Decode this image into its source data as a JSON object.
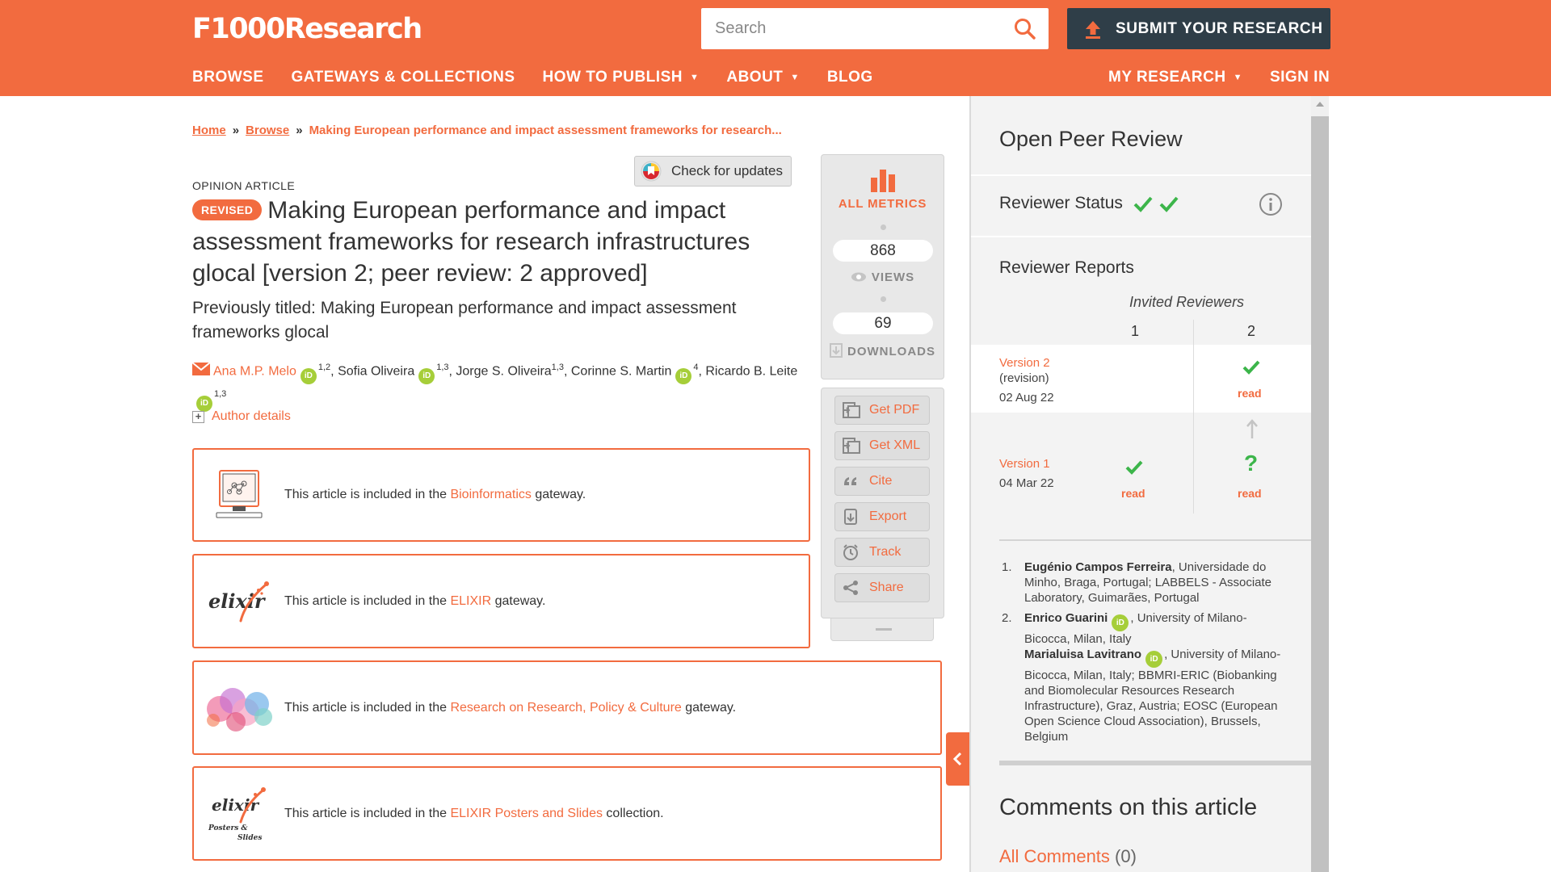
{
  "header": {
    "logo": "F1000Research",
    "search_placeholder": "Search",
    "submit_label": "SUBMIT YOUR RESEARCH",
    "nav_left": [
      "BROWSE",
      "GATEWAYS & COLLECTIONS",
      "HOW TO PUBLISH",
      "ABOUT",
      "BLOG"
    ],
    "nav_right": [
      "MY RESEARCH",
      "SIGN IN"
    ]
  },
  "breadcrumb": {
    "home": "Home",
    "browse": "Browse",
    "sep": "»",
    "current": "Making European performance and impact assessment frameworks for research..."
  },
  "article": {
    "check_updates": "Check for updates",
    "type": "OPINION ARTICLE",
    "badge": "REVISED",
    "title": "Making European performance and impact assessment frameworks for research infrastructures glocal [version 2; peer review: 2 approved]",
    "previous_title": "Previously titled: Making European performance and impact assessment frameworks glocal",
    "authors": [
      {
        "name": "Ana M.P. Melo",
        "aff": "1,2"
      },
      {
        "name": "Sofia Oliveira",
        "aff": "1,3"
      },
      {
        "name": "Jorge S. Oliveira",
        "aff": "1,3"
      },
      {
        "name": "Corinne S. Martin",
        "aff": "4"
      },
      {
        "name": "Ricardo B. Leite",
        "aff": "1,3"
      }
    ],
    "orcid_label": "iD",
    "author_details": "Author details",
    "plus": "+"
  },
  "gateways": [
    {
      "prefix": "This article is included in the ",
      "link": "Bioinformatics",
      "suffix": " gateway."
    },
    {
      "prefix": "This article is included in the ",
      "link": "ELIXIR",
      "suffix": " gateway."
    },
    {
      "prefix": "This article is included in the ",
      "link": "Research on Research, Policy & Culture",
      "suffix": " gateway."
    },
    {
      "prefix": "This article is included in the ",
      "link": "ELIXIR Posters and Slides",
      "suffix": " collection."
    }
  ],
  "logos": {
    "elixir": "elixir",
    "elixir_posters_line1": "Posters &",
    "elixir_posters_line2": "Slides"
  },
  "metrics": {
    "all_metrics": "ALL METRICS",
    "views_count": "868",
    "views_label": "VIEWS",
    "downloads_count": "69",
    "downloads_label": "DOWNLOADS"
  },
  "tools": [
    "Get PDF",
    "Get XML",
    "Cite",
    "Export",
    "Track",
    "Share"
  ],
  "review": {
    "title": "Open Peer Review",
    "status_label": "Reviewer Status",
    "reports_label": "Reviewer Reports",
    "invited_label": "Invited Reviewers",
    "col1": "1",
    "col2": "2",
    "v2_label": "Version 2",
    "v2_sub": "(revision)",
    "v2_date": "02 Aug 22",
    "v1_label": "Version 1",
    "v1_date": "04 Mar 22",
    "read": "read",
    "question": "?",
    "reviewers": [
      {
        "num": "1.",
        "name": "Eugénio Campos Ferreira",
        "detail": ", Universidade do Minho, Braga, Portugal; LABBELS - Associate Laboratory, Guimarães, Portugal"
      },
      {
        "num": "2.",
        "name": "Enrico Guarini",
        "detail": ", University of Milano-Bicocca, Milan, Italy",
        "name2": "Marialuisa Lavitrano",
        "detail2": ", University of Milano-Bicocca, Milan, Italy; BBMRI-ERIC (Biobanking and Biomolecular Resources Research Infrastructure), Graz, Austria; EOSC (European Open Science Cloud Association), Brussels, Belgium"
      }
    ],
    "comments_title": "Comments on this article",
    "all_comments": "All Comments",
    "comment_count": "(0)"
  },
  "colors": {
    "accent": "#f26b3f",
    "dark": "#2f3e48",
    "green": "#3cb54a",
    "orcid": "#a6ce39"
  }
}
